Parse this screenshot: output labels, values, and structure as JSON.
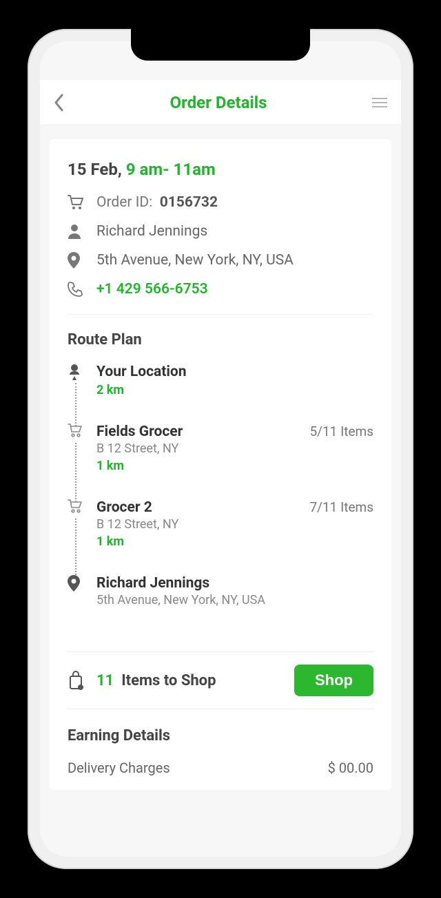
{
  "header": {
    "title": "Order Details"
  },
  "order": {
    "date_prefix": "15 Feb, ",
    "time_window": "9 am- 11am",
    "order_id_label": "Order ID:",
    "order_id": "0156732",
    "customer_name": "Richard Jennings",
    "address": "5th Avenue, New York, NY, USA",
    "phone": "+1 429 566-6753"
  },
  "route": {
    "title": "Route Plan",
    "stops": [
      {
        "title": "Your Location",
        "sub": "",
        "distance": "2 km",
        "items": ""
      },
      {
        "title": "Fields Grocer",
        "sub": "B 12 Street, NY",
        "distance": "1 km",
        "items": "5/11 Items"
      },
      {
        "title": "Grocer 2",
        "sub": "B 12 Street, NY",
        "distance": "1 km",
        "items": "7/11 Items"
      },
      {
        "title": "Richard Jennings",
        "sub": "5th Avenue, New York, NY, USA",
        "distance": "",
        "items": ""
      }
    ]
  },
  "shop": {
    "count": "11",
    "label": "Items to Shop",
    "button": "Shop"
  },
  "earning": {
    "title": "Earning Details",
    "rows": [
      {
        "label": "Delivery Charges",
        "value": "$ 00.00"
      }
    ]
  }
}
